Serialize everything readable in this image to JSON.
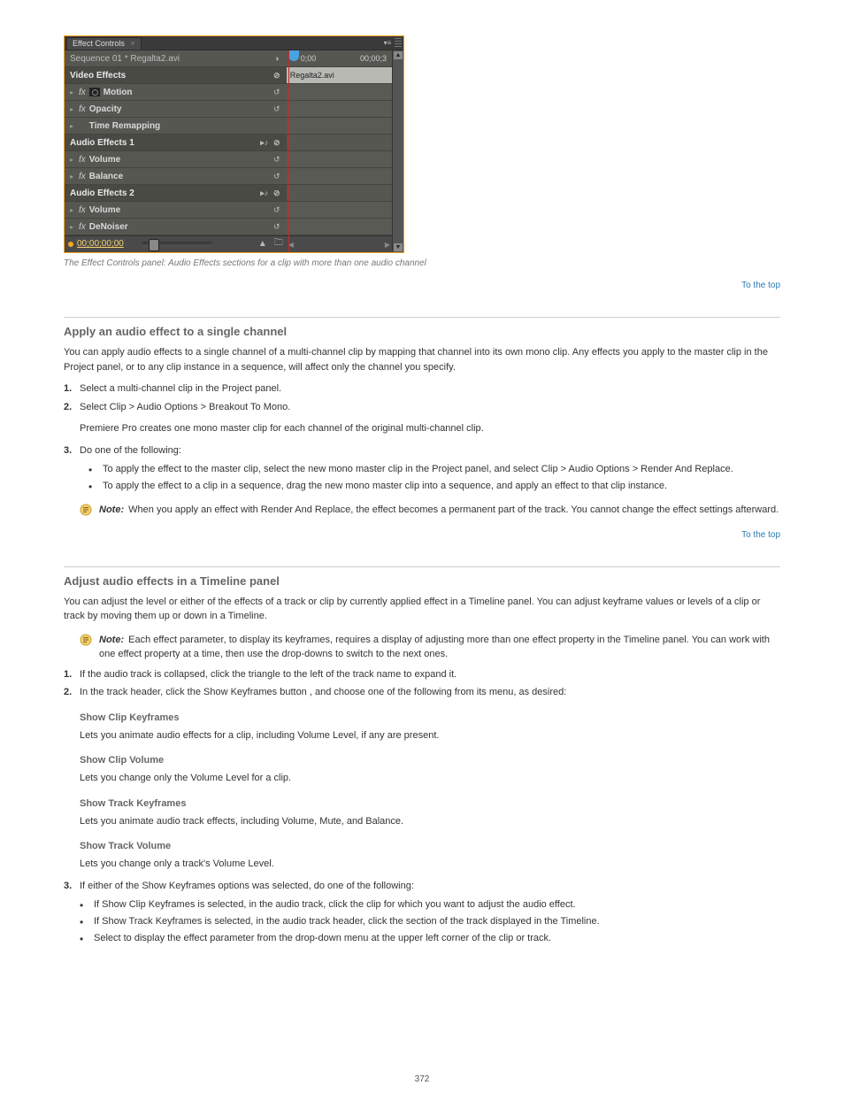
{
  "panel": {
    "tab_label": "Effect Controls",
    "sequence_row": "Sequence 01 * Regalta2.avi",
    "sections": {
      "video_effects": "Video Effects",
      "motion": "Motion",
      "opacity": "Opacity",
      "time_remapping": "Time Remapping",
      "audio_effects_1": "Audio Effects 1",
      "volume1": "Volume",
      "balance": "Balance",
      "audio_effects_2": "Audio Effects 2",
      "volume2": "Volume",
      "denoiser": "DeNoiser"
    },
    "ruler": {
      "start": "0;00",
      "end": "00;00;3",
      "playhead_glyph": "r"
    },
    "clip_name": "Regalta2.avi",
    "footer_timecode": "00;00;00;00"
  },
  "caption": "The Effect Controls panel: Audio Effects sections for a clip with more than one audio channel",
  "section1": {
    "top": "To the top",
    "title": "Apply an audio effect to a single channel",
    "p1": "You can apply audio effects to a single channel of a multi-channel clip by mapping that channel into its own mono clip. Any effects you apply to the master clip in the Project panel, or to any clip instance in a sequence, will affect only the channel you specify.",
    "step1_num": "1.",
    "step1": "Select a multi-channel clip in the Project panel.",
    "step2_num": "2.",
    "step2": "Select Clip > Audio Options > Breakout To Mono.",
    "step2_b": "Premiere Pro creates one mono master clip for each channel of the original multi-channel clip.",
    "step3_num": "3.",
    "step3": "Do one of the following:",
    "bullet1": "To apply the effect to the master clip, select the new mono master clip in the Project panel, and select Clip > Audio Options > Render And Replace.",
    "bullet2": "To apply the effect to a clip in a sequence, drag the new mono master clip into a sequence, and apply an effect to that clip instance.",
    "note_label": "Note:",
    "note": "When you apply an effect with Render And Replace, the effect becomes a permanent part of the track. You cannot change the effect settings afterward."
  },
  "section2": {
    "top": "To the top",
    "title": "Adjust audio effects in a Timeline panel",
    "p1": "You can adjust the level or either of the effects of a track or clip by currently applied effect in a Timeline panel. You can adjust keyframe values or levels of a clip or track by moving them up or down in a Timeline.",
    "note_label": "Note:",
    "note": "Each effect parameter, to display its keyframes, requires a display of adjusting more than one effect property in the Timeline panel. You can work with one effect property at a time, then use the drop-downs to switch to the next ones.",
    "step1_num": "1.",
    "step1": "If the audio track is collapsed, click the triangle to the left of the track name to expand it.",
    "step2_num": "2.",
    "step2": "In the track header, click the Show Keyframes button  , and choose one of the following from its menu, as desired:",
    "show_clip_kf_label": "Show Clip Keyframes",
    "show_clip_kf": "Lets you animate audio effects for a clip, including Volume Level, if any are present.",
    "show_clip_vol_label": "Show Clip Volume",
    "show_clip_vol": "Lets you change only the Volume Level for a clip.",
    "show_track_kf_label": "Show Track Keyframes",
    "show_track_kf": "Lets you animate audio track effects, including Volume, Mute, and Balance.",
    "show_track_vol_label": "Show Track Volume",
    "show_track_vol": "Lets you change only a track's Volume Level.",
    "step3_num": "3.",
    "step3": "If either of the Show Keyframes options was selected, do one of the following:",
    "b1": "If Show Clip Keyframes is selected, in the audio track, click the clip for which you want to adjust the audio effect.",
    "b2": "If Show Track Keyframes is selected, in the audio track header, click the section of the track displayed in the Timeline.",
    "b3": "Select to display the effect parameter from the drop-down menu at the upper left corner of the clip or track."
  },
  "page_number": "372"
}
